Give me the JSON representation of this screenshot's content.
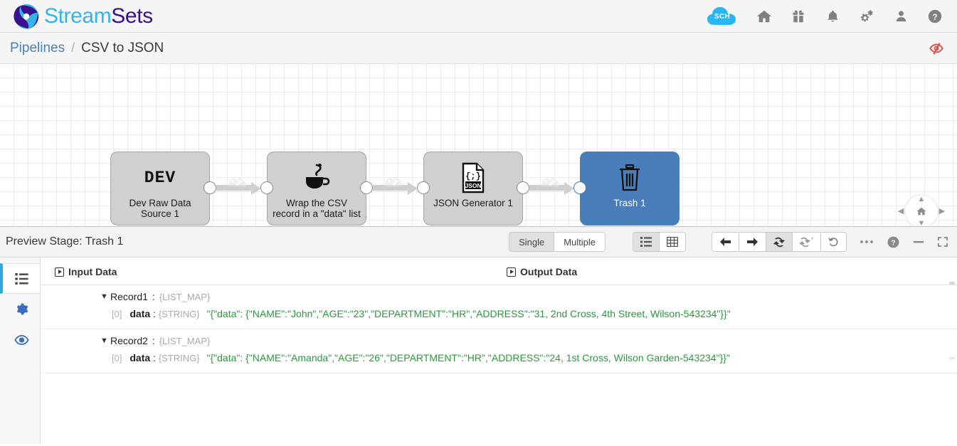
{
  "app": {
    "brand_first": "Stream",
    "brand_second": "Sets",
    "accent_blue": "#34b5e8",
    "accent_purple": "#3b0f8f"
  },
  "topnav": {
    "sch_badge_label": "SCH",
    "icons": [
      {
        "name": "home-icon",
        "title": "Home"
      },
      {
        "name": "gift-icon",
        "title": "What's New"
      },
      {
        "name": "bell-icon",
        "title": "Notifications"
      },
      {
        "name": "gears-icon",
        "title": "Administration"
      },
      {
        "name": "user-icon",
        "title": "User"
      },
      {
        "name": "help-icon",
        "title": "Help"
      }
    ]
  },
  "breadcrumb": {
    "parent": "Pipelines",
    "separator": "/",
    "current": "CSV to JSON",
    "stop_preview_title": "Stop Preview"
  },
  "canvas": {
    "stages": [
      {
        "label": "Dev Raw Data Source 1",
        "icon": "dev-text-icon",
        "icon_text": "DEV",
        "selected": false
      },
      {
        "label": "Wrap the CSV record in a \"data\" list",
        "icon": "jython-cup-icon",
        "selected": false
      },
      {
        "label": "JSON Generator 1",
        "icon": "json-file-icon",
        "icon_text": "JSON",
        "selected": false
      },
      {
        "label": "Trash 1",
        "icon": "trash-icon",
        "selected": true
      }
    ],
    "navigation": {
      "up": "▲",
      "down": "▼",
      "left": "◀",
      "right": "▶",
      "home": "home-icon",
      "zoom_in": "+",
      "zoom_out": "−"
    }
  },
  "preview": {
    "title": "Preview Stage: Trash 1",
    "mode_toggle": [
      {
        "label": "Single",
        "active": true
      },
      {
        "label": "Multiple",
        "active": false
      }
    ],
    "view_toggle": [
      {
        "name": "list-view-icon",
        "active": true
      },
      {
        "name": "table-view-icon",
        "active": false
      }
    ],
    "actions": [
      {
        "name": "step-back-icon",
        "active": false
      },
      {
        "name": "step-forward-icon",
        "active": false
      },
      {
        "name": "run-preview-icon",
        "active": true
      },
      {
        "name": "run-preview-with-options-icon",
        "active": false
      },
      {
        "name": "reset-offset-icon",
        "active": false
      }
    ],
    "right_actions": [
      {
        "name": "more-options-icon"
      },
      {
        "name": "help-icon"
      },
      {
        "name": "minimize-icon"
      },
      {
        "name": "maximize-icon"
      }
    ],
    "rail": [
      {
        "name": "preview-data-icon",
        "active": true
      },
      {
        "name": "configuration-icon",
        "active": false
      },
      {
        "name": "preview-eye-icon",
        "active": false
      }
    ],
    "columns": {
      "input": "Input Data",
      "output": "Output Data"
    },
    "records": [
      {
        "caret": "▼",
        "name": "Record1",
        "colon": ":",
        "type": "{LIST_MAP}",
        "fields": [
          {
            "index": "[0]",
            "name": "data",
            "colon": ":",
            "type": "{STRING}",
            "value": "\"{\"data\": {\"NAME\":\"John\",\"AGE\":\"23\",\"DEPARTMENT\":\"HR\",\"ADDRESS\":\"31, 2nd Cross, 4th Street, Wilson-543234\"}}\""
          }
        ]
      },
      {
        "caret": "▼",
        "name": "Record2",
        "colon": ":",
        "type": "{LIST_MAP}",
        "fields": [
          {
            "index": "[0]",
            "name": "data",
            "colon": ":",
            "type": "{STRING}",
            "value": "\"{\"data\": {\"NAME\":\"Amanda\",\"AGE\":\"26\",\"DEPARTMENT\":\"HR\",\"ADDRESS\":\"24, 1st Cross, Wilson Garden-543234\"}}\""
          }
        ]
      }
    ]
  }
}
